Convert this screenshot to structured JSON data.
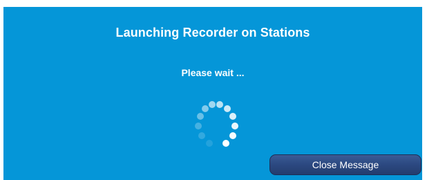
{
  "dialog": {
    "title": "Launching Recorder on Stations",
    "message": "Please wait ...",
    "spinner_icon": "loading-spinner-icon",
    "close_button_label": "Close Message",
    "colors": {
      "background": "#0596d8",
      "text": "#ffffff",
      "button": "#2d4a82"
    }
  }
}
